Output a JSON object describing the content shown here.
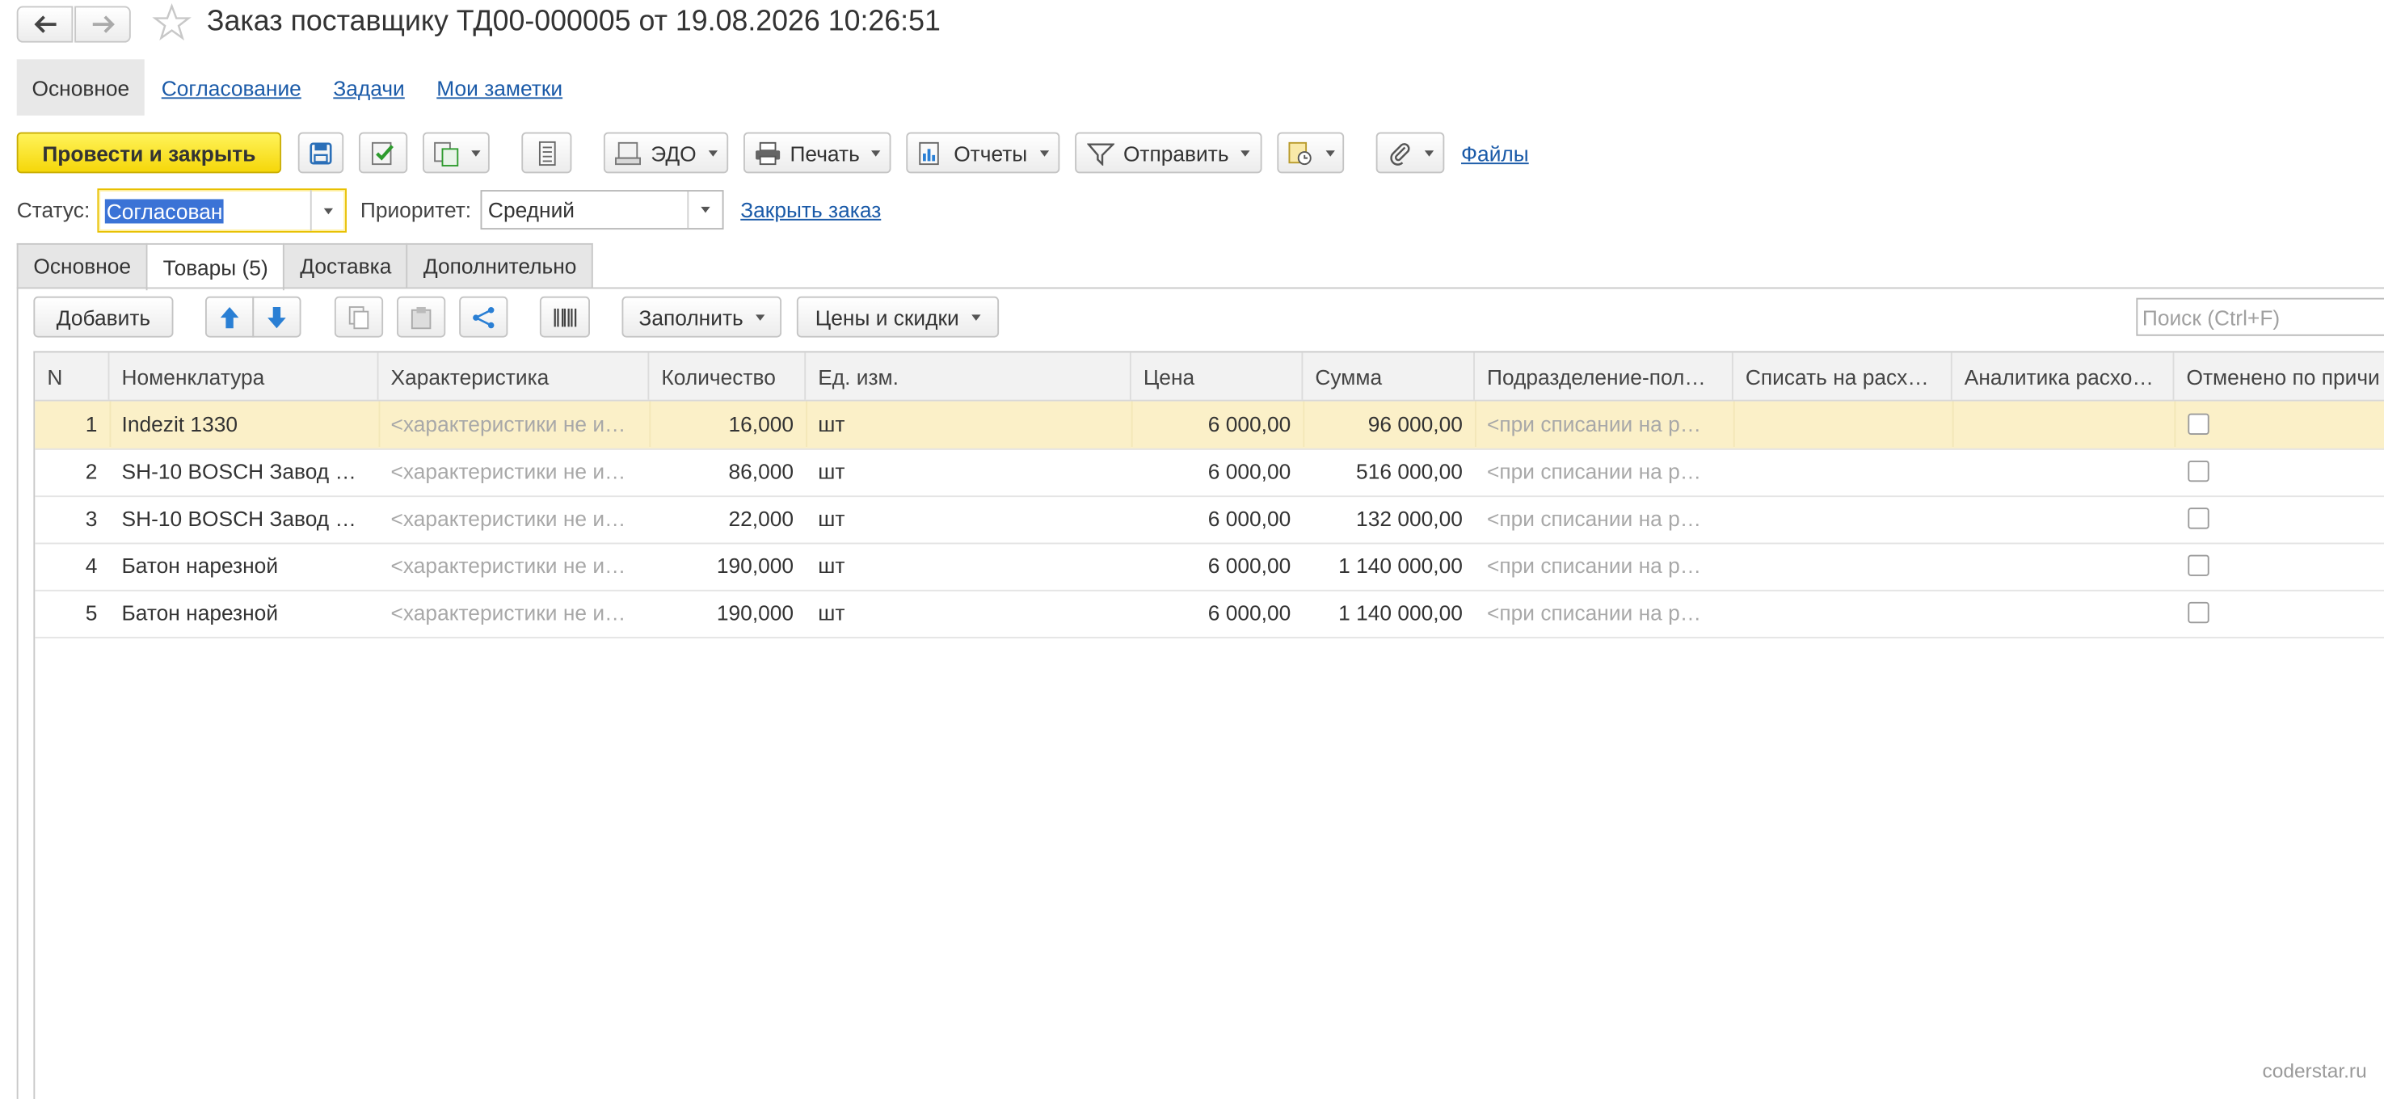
{
  "window": {
    "title": "Заказ поставщику ТД00-000005 от 19.08.2026 10:26:51"
  },
  "linkbar": {
    "items": [
      "Основное",
      "Согласование",
      "Задачи",
      "Мои заметки"
    ]
  },
  "toolbar": {
    "post_close": "Провести и закрыть",
    "edo": "ЭДО",
    "print": "Печать",
    "reports": "Отчеты",
    "send": "Отправить",
    "files": "Файлы"
  },
  "form": {
    "status_label": "Статус:",
    "status_value": "Согласован",
    "priority_label": "Приоритет:",
    "priority_value": "Средний",
    "close_order": "Закрыть заказ"
  },
  "tabs": [
    "Основное",
    "Товары (5)",
    "Доставка",
    "Дополнительно"
  ],
  "goods_toolbar": {
    "add": "Добавить",
    "fill": "Заполнить",
    "prices": "Цены и скидки",
    "search_placeholder": "Поиск (Ctrl+F)"
  },
  "table": {
    "columns": [
      "N",
      "Номенклатура",
      "Характеристика",
      "Количество",
      "Ед. изм.",
      "Цена",
      "Сумма",
      "Подразделение-пол…",
      "Списать на расх…",
      "Аналитика расхо…",
      "Отменено по причи"
    ],
    "rows": [
      {
        "n": "1",
        "item": "Indezit 1330",
        "char": "<характеристики не и…",
        "qty": "16,000",
        "unit": "шт",
        "price": "6 000,00",
        "sum": "96 000,00",
        "dept": "<при списании на р…",
        "writeoff": "",
        "analytics": "",
        "cancelled": false
      },
      {
        "n": "2",
        "item": "SH-10 BOSCH Завод …",
        "char": "<характеристики не и…",
        "qty": "86,000",
        "unit": "шт",
        "price": "6 000,00",
        "sum": "516 000,00",
        "dept": "<при списании на р…",
        "writeoff": "",
        "analytics": "",
        "cancelled": false
      },
      {
        "n": "3",
        "item": "SH-10 BOSCH Завод …",
        "char": "<характеристики не и…",
        "qty": "22,000",
        "unit": "шт",
        "price": "6 000,00",
        "sum": "132 000,00",
        "dept": "<при списании на р…",
        "writeoff": "",
        "analytics": "",
        "cancelled": false
      },
      {
        "n": "4",
        "item": "Батон нарезной",
        "char": "<характеристики не и…",
        "qty": "190,000",
        "unit": "шт",
        "price": "6 000,00",
        "sum": "1 140 000,00",
        "dept": "<при списании на р…",
        "writeoff": "",
        "analytics": "",
        "cancelled": false
      },
      {
        "n": "5",
        "item": "Батон нарезной",
        "char": "<характеристики не и…",
        "qty": "190,000",
        "unit": "шт",
        "price": "6 000,00",
        "sum": "1 140 000,00",
        "dept": "<при списании на р…",
        "writeoff": "",
        "analytics": "",
        "cancelled": false
      }
    ],
    "selected_row": 1
  },
  "watermark": "coderstar.ru",
  "colors": {
    "accent_yellow": "#f5d70a",
    "link_blue": "#1a5aa8",
    "selected_row": "#fbf0c8",
    "selection_blue": "#3b73d6",
    "icon_blue": "#2a7fd4"
  }
}
